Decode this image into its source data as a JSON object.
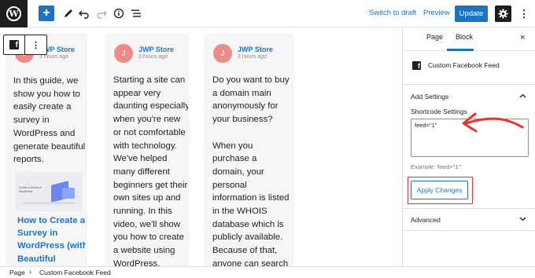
{
  "toolbar": {
    "logo_letter": "W",
    "add_icon": "plus-icon",
    "switch_to_draft": "Switch to draft",
    "preview": "Preview",
    "update": "Update",
    "icons": [
      "plus-icon",
      "pencil-icon",
      "undo-icon",
      "redo-icon",
      "info-icon",
      "list-view-icon",
      "gear-icon",
      "more-vertical-icon"
    ]
  },
  "block_toolbar": {
    "icon": "facebook-icon",
    "options_glyph": "⋮"
  },
  "feed": {
    "posts": [
      {
        "avatar_letter": "J",
        "author": "JWP Store",
        "time": "3 hours ago",
        "text": "In this guide, we show you how to easily create a survey in WordPress and generate beautiful reports.",
        "link_title": "How to Create a Survey in WordPress (with Beautiful Reports)",
        "thumb_caption": "Create a Survey in WordPress"
      },
      {
        "avatar_letter": "J",
        "author": "JWP Store",
        "time": "3 hours ago",
        "text": "Starting a site can appear very daunting especially when you're new or not comfortable with technology. We've helped many different beginners get their own sites up and running. In this video, we'll show you how to create a website using WordPress."
      },
      {
        "avatar_letter": "J",
        "author": "JWP Store",
        "time": "3 hours ago",
        "text": "Do you want to buy a domain main anonymously for your business?\n\nWhen you purchase a domain, your personal information is listed in the WHOIS database which is publicly available. Because of that, anyone can search and"
      }
    ]
  },
  "sidebar": {
    "tabs": [
      "Page",
      "Block"
    ],
    "active_tab": "Block",
    "close_glyph": "×",
    "block_name": "Custom Facebook Feed",
    "add_settings": "Add Settings",
    "shortcode_label": "Shortcode Settings",
    "shortcode_value": "feed=\"1\"",
    "example": "Example: 'feed=\"1\"'",
    "apply": "Apply Changes",
    "advanced": "Advanced",
    "chevron_up": "^",
    "chevron_down": "v"
  },
  "breadcrumb": {
    "page": "Page",
    "separator": "›",
    "current": "Custom Facebook Feed"
  },
  "colors": {
    "accent": "#1e73be",
    "annotation": "#e3342f",
    "avatar": "#f08a8a",
    "dark": "#1e1e1e"
  }
}
